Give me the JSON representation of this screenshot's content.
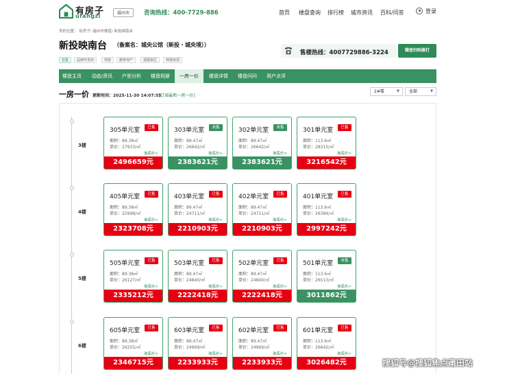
{
  "header": {
    "logo_cn": "有房子",
    "logo_en": "ufangzi",
    "city": "福州市",
    "hotline": "咨询热线：400-7729-886",
    "nav": [
      "首页",
      "楼盘查询",
      "排行榜",
      "城市资讯",
      "百科/问答"
    ],
    "login": "登录"
  },
  "breadcrumb": "你的位置：  有房子/ 福州市楼盘/ 新投映南台",
  "project": {
    "title": "新投映南台",
    "subtitle": "（备案名：城央公馆（新投・城央境））",
    "tags": [
      "在售",
      "品牌开发商",
      "地铁",
      "教育地产",
      "视图景区",
      "特惠房源"
    ],
    "phone_label": "售楼热线：4007729886-3224",
    "wechat_btn": "微信扫码拨打"
  },
  "tabs": [
    "楼盘主页",
    "动态/资讯",
    "户型分析",
    "楼盘相册",
    "一房一价",
    "楼盘详情",
    "楼盘问问",
    "用户点评"
  ],
  "section": {
    "title": "一房一价",
    "update": "更新时间：2025-11-30 14:07:55",
    "subscribe": "[订阅最新一房一价]",
    "building_select": "2#楼",
    "filter_select": "全部"
  },
  "ask_label": "询底价>",
  "floors": [
    {
      "label": "3楼",
      "units": [
        {
          "room": "305单元室",
          "status": "已售",
          "sold": true,
          "area": "面积：89.38㎡",
          "unit_price": "单价：27933/㎡",
          "total": "2496659元"
        },
        {
          "room": "303单元室",
          "status": "未售",
          "sold": false,
          "area": "面积：89.47㎡",
          "unit_price": "单价：26642/㎡",
          "total": "2383621元"
        },
        {
          "room": "302单元室",
          "status": "未售",
          "sold": false,
          "area": "面积：89.47㎡",
          "unit_price": "单价：26642/㎡",
          "total": "2383621元"
        },
        {
          "room": "301单元室",
          "status": "已售",
          "sold": true,
          "area": "面积：113.6㎡",
          "unit_price": "单价：28315/㎡",
          "total": "3216542元"
        }
      ]
    },
    {
      "label": "4楼",
      "units": [
        {
          "room": "405单元室",
          "status": "已售",
          "sold": true,
          "area": "面积：89.38㎡",
          "unit_price": "单价：25998/㎡",
          "total": "2323708元"
        },
        {
          "room": "403单元室",
          "status": "已售",
          "sold": true,
          "area": "面积：89.47㎡",
          "unit_price": "单价：24711/㎡",
          "total": "2210903元"
        },
        {
          "room": "402单元室",
          "status": "已售",
          "sold": true,
          "area": "面积：89.47㎡",
          "unit_price": "单价：24711/㎡",
          "total": "2210903元"
        },
        {
          "room": "401单元室",
          "status": "已售",
          "sold": true,
          "area": "面积：113.6㎡",
          "unit_price": "单价：26384/㎡",
          "total": "2997242元"
        }
      ]
    },
    {
      "label": "5楼",
      "units": [
        {
          "room": "505单元室",
          "status": "已售",
          "sold": true,
          "area": "面积：89.38㎡",
          "unit_price": "单价：26127/㎡",
          "total": "2335212元"
        },
        {
          "room": "503单元室",
          "status": "已售",
          "sold": true,
          "area": "面积：89.47㎡",
          "unit_price": "单价：24840/㎡",
          "total": "2222418元"
        },
        {
          "room": "502单元室",
          "status": "已售",
          "sold": true,
          "area": "面积：89.47㎡",
          "unit_price": "单价：24840/㎡",
          "total": "2222418元"
        },
        {
          "room": "501单元室",
          "status": "未售",
          "sold": false,
          "area": "面积：113.6㎡",
          "unit_price": "单价：26513/㎡",
          "total": "3011862元"
        }
      ]
    },
    {
      "label": "6楼",
      "units": [
        {
          "room": "605单元室",
          "status": "已售",
          "sold": true,
          "area": "面积：89.38㎡",
          "unit_price": "单价：26255/㎡",
          "total": "2346715元"
        },
        {
          "room": "603单元室",
          "status": "已售",
          "sold": true,
          "area": "面积：89.47㎡",
          "unit_price": "单价：24969/㎡",
          "total": "2233933元"
        },
        {
          "room": "602单元室",
          "status": "已售",
          "sold": true,
          "area": "面积：89.47㎡",
          "unit_price": "单价：24969/㎡",
          "total": "2233933元"
        },
        {
          "room": "601单元室",
          "status": "已售",
          "sold": true,
          "area": "面积：113.6㎡",
          "unit_price": "单价：26642/㎡",
          "total": "3026482元"
        }
      ]
    }
  ],
  "watermark": "搜狐号@搜狐焦点莆田站",
  "colors": {
    "brand_green": "#3a9162",
    "sold_red": "#e60012",
    "price_green": "#2e8b57"
  },
  "icons": [
    "house-logo-icon",
    "user-icon",
    "phone-icon"
  ]
}
